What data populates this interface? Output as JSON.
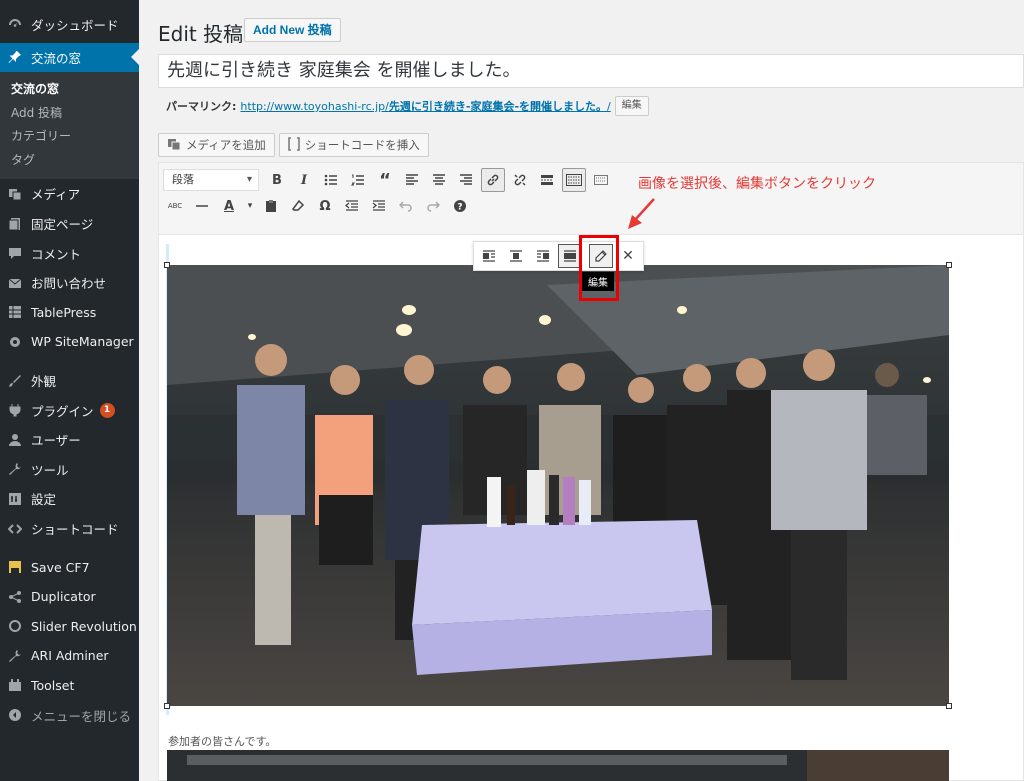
{
  "sidebar": {
    "items_top": [
      {
        "label": "ダッシュボード",
        "icon": "dashboard-icon"
      },
      {
        "label": "交流の窓",
        "icon": "pin-icon",
        "current": true
      }
    ],
    "submenu": [
      {
        "label": "交流の窓",
        "active": true
      },
      {
        "label": "Add 投稿",
        "active": false
      },
      {
        "label": "カテゴリー",
        "active": false
      },
      {
        "label": "タグ",
        "active": false
      }
    ],
    "items_group1": [
      {
        "label": "メディア",
        "icon": "media-icon"
      },
      {
        "label": "固定ページ",
        "icon": "page-icon"
      },
      {
        "label": "コメント",
        "icon": "comment-icon"
      },
      {
        "label": "お問い合わせ",
        "icon": "mail-icon"
      },
      {
        "label": "TablePress",
        "icon": "table-icon"
      },
      {
        "label": "WP SiteManager",
        "icon": "gear-icon"
      }
    ],
    "items_group2": [
      {
        "label": "外観",
        "icon": "brush-icon"
      },
      {
        "label": "プラグイン",
        "icon": "plugin-icon",
        "badge": "1"
      },
      {
        "label": "ユーザー",
        "icon": "user-icon"
      },
      {
        "label": "ツール",
        "icon": "wrench-icon"
      },
      {
        "label": "設定",
        "icon": "settings-icon"
      },
      {
        "label": "ショートコード",
        "icon": "code-icon"
      }
    ],
    "items_group3": [
      {
        "label": "Save CF7",
        "icon": "save-icon"
      },
      {
        "label": "Duplicator",
        "icon": "share-icon"
      },
      {
        "label": "Slider Revolution",
        "icon": "refresh-icon"
      },
      {
        "label": "ARI Adminer",
        "icon": "wrench-icon"
      },
      {
        "label": "Toolset",
        "icon": "toolset-icon"
      },
      {
        "label": "メニューを閉じる",
        "icon": "collapse-icon"
      }
    ]
  },
  "header": {
    "title": "Edit 投稿",
    "add_new": "Add New 投稿"
  },
  "post": {
    "title": "先週に引き続き 家庭集会 を開催しました。",
    "permalink_label": "パーマリンク:",
    "permalink_base": "http://www.toyohashi-rc.jp/",
    "permalink_slug": "先週に引き続き-家庭集会-を開催しました。",
    "permalink_end": "/",
    "edit_slug_label": "編集"
  },
  "media_buttons": {
    "add_media": "メディアを追加",
    "insert_shortcode": "ショートコードを挿入"
  },
  "toolbar": {
    "format_select": "段落"
  },
  "annotation": {
    "text": "画像を選択後、編集ボタンをクリック",
    "color": "#e53935"
  },
  "image_toolbar": {
    "tooltip": "編集"
  },
  "content": {
    "caption": "参加者の皆さんです。"
  },
  "colors": {
    "sidebar_bg": "#23282d",
    "current_bg": "#0073aa",
    "highlight_border": "#e00000"
  }
}
